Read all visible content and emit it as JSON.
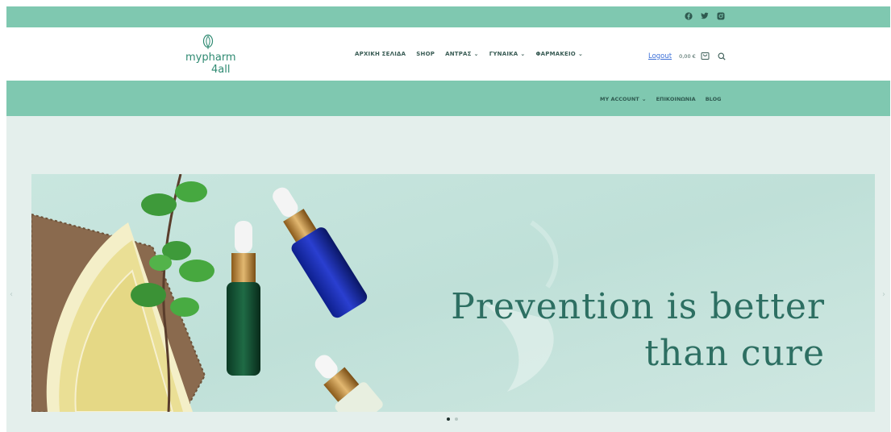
{
  "topbar": {
    "social_icons": [
      "facebook-icon",
      "twitter-icon",
      "instagram-icon"
    ]
  },
  "logo": {
    "line1": "mypharm",
    "line2": "4all"
  },
  "main_nav": [
    {
      "label": "ΑΡΧΙΚΗ ΣΕΛΙΔΑ",
      "active": true,
      "dropdown": false
    },
    {
      "label": "SHOP",
      "active": false,
      "dropdown": false
    },
    {
      "label": "ΑΝΤΡΑΣ",
      "active": false,
      "dropdown": true
    },
    {
      "label": "ΓΥΝΑΙΚΑ",
      "active": false,
      "dropdown": true
    },
    {
      "label": "ΦΑΡΜΑΚΕΙΟ",
      "active": false,
      "dropdown": true
    }
  ],
  "header_right": {
    "logout": "Logout",
    "cart_total": "0,00 €",
    "icons": [
      "cart-icon",
      "search-icon"
    ]
  },
  "sub_nav": [
    {
      "label": "MY ACCOUNT",
      "dropdown": true
    },
    {
      "label": "ΕΠΙΚΟΙΝΩΝΙΑ",
      "dropdown": false
    },
    {
      "label": "BLOG",
      "dropdown": false
    }
  ],
  "slider": {
    "headline_line1": "Prevention is better",
    "headline_line2": "than cure",
    "active_slide": 1,
    "slide_count": 2
  },
  "colors": {
    "accent_green": "#7fc8b0",
    "link_blue": "#3b6fd8",
    "headline_teal": "#2d6f62",
    "page_bg": "#e4efec"
  }
}
